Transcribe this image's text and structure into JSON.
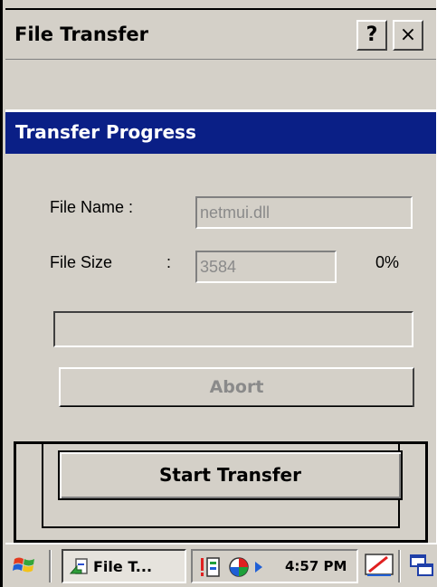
{
  "window": {
    "title": "File Transfer",
    "help_label": "?",
    "close_label": "×"
  },
  "panel": {
    "header": "Transfer Progress",
    "file_name_label": "File Name :",
    "file_name_value": "netmui.dll",
    "file_size_label": "File Size",
    "file_size_colon": ":",
    "file_size_value": "3584",
    "percent": "0%",
    "progress": 0,
    "abort_label": "Abort",
    "start_label": "Start Transfer"
  },
  "taskbar": {
    "task_label": "File T...",
    "time": "4:57 PM",
    "icons": [
      "windows-start-icon",
      "file-transfer-icon",
      "alert-icon",
      "network-icon",
      "arrow-icon",
      "pen-icon",
      "desktop-icon"
    ]
  },
  "colors": {
    "header_blue": "#0a1f86",
    "face": "#d4d0c8"
  }
}
